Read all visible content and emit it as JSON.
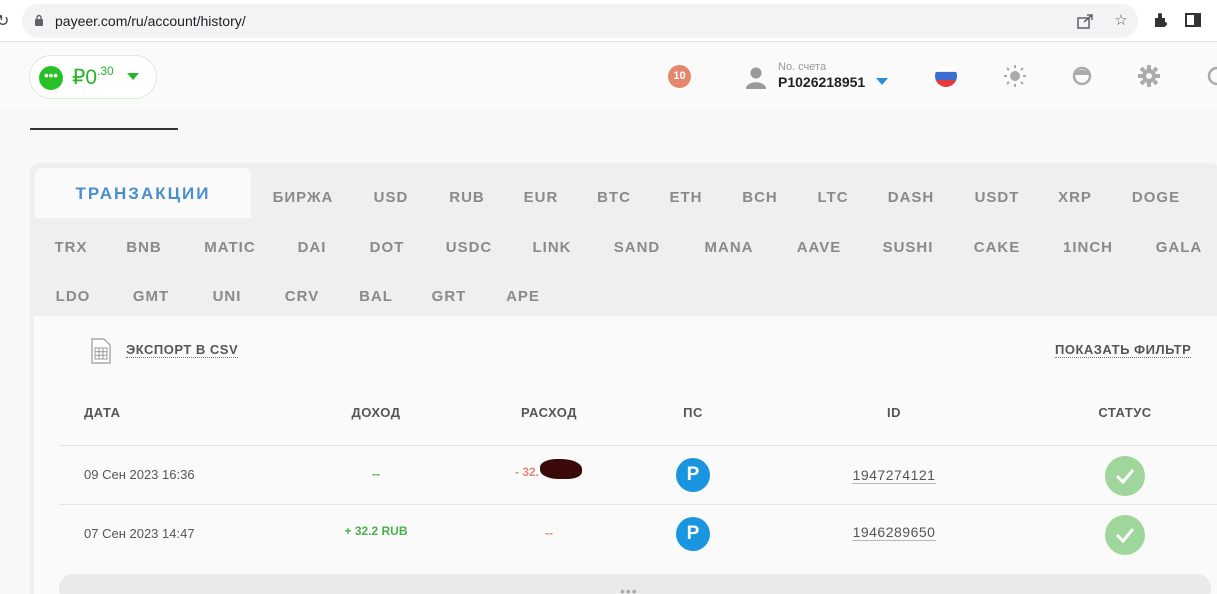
{
  "browser": {
    "url": "payeer.com/ru/account/history/"
  },
  "header": {
    "balance_whole": "₽0",
    "balance_fraction": ".30",
    "notifications": "10",
    "account_label": "No. счета",
    "account_number": "P1026218951"
  },
  "tabs": {
    "active": "ТРАНЗАКЦИИ",
    "row1": [
      "БИРЖА",
      "USD",
      "RUB",
      "EUR",
      "BTC",
      "ETH",
      "BCH",
      "LTC",
      "DASH",
      "USDT",
      "XRP",
      "DOGE"
    ],
    "row2": [
      "TRX",
      "BNB",
      "MATIC",
      "DAI",
      "DOT",
      "USDC",
      "LINK",
      "SAND",
      "MANA",
      "AAVE",
      "SUSHI",
      "CAKE",
      "1INCH",
      "GALA"
    ],
    "row3": [
      "LDO",
      "GMT",
      "UNI",
      "CRV",
      "BAL",
      "GRT",
      "APE"
    ]
  },
  "toolbar": {
    "export_label": "ЭКСПОРТ В CSV",
    "filter_label": "ПОКАЗАТЬ ФИЛЬТР"
  },
  "table": {
    "headers": {
      "date": "ДАТА",
      "income": "ДОХОД",
      "expense": "РАСХОД",
      "ps": "ПС",
      "id": "ID",
      "status": "СТАТУС"
    },
    "rows": [
      {
        "date": "09 Сен 2023 16:36",
        "income": "--",
        "expense": "- 32.",
        "ps": "P",
        "id": "1947274121"
      },
      {
        "date": "07 Сен 2023 14:47",
        "income": "+ 32.2 RUB",
        "expense": "--",
        "ps": "P",
        "id": "1946289650"
      }
    ]
  },
  "more": "•••"
}
